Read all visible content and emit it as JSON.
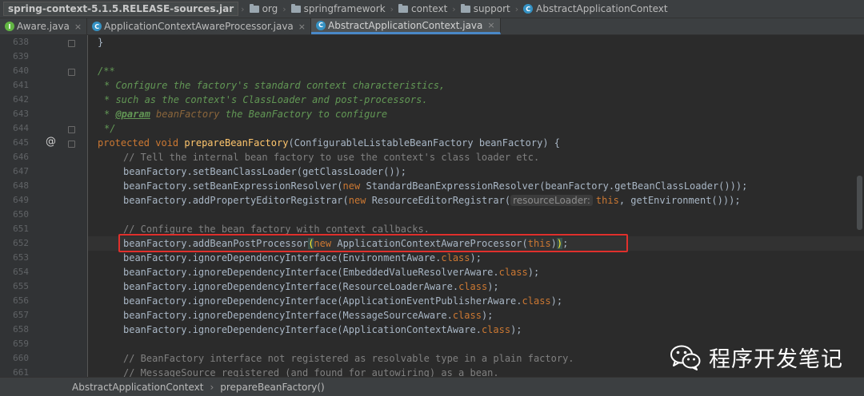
{
  "navbar": {
    "crumbs": [
      "spring-context-5.1.5.RELEASE-sources.jar",
      "org",
      "springframework",
      "context",
      "support",
      "AbstractApplicationContext"
    ]
  },
  "tabs": [
    {
      "label": "Aware.java",
      "icon": "interface-icon",
      "active": false
    },
    {
      "label": "ApplicationContextAwareProcessor.java",
      "icon": "class-icon",
      "active": false
    },
    {
      "label": "AbstractApplicationContext.java",
      "icon": "class-icon",
      "active": true
    }
  ],
  "line_numbers": [
    "638",
    "639",
    "640",
    "641",
    "642",
    "643",
    "644",
    "645",
    "646",
    "647",
    "648",
    "649",
    "650",
    "651",
    "652",
    "653",
    "654",
    "655",
    "656",
    "657",
    "658",
    "659",
    "660",
    "661"
  ],
  "code": {
    "l638": "}",
    "l640": "/**",
    "l641": "* Configure the factory's standard context characteristics,",
    "l642": "* such as the context's ClassLoader and post-processors.",
    "l643_tag": "@param",
    "l643_name": "beanFactory",
    "l643_rest": "the BeanFactory to configure",
    "l644": "*/",
    "l645_kw": "protected void",
    "l645_fn": "prepareBeanFactory",
    "l645_rest": "(ConfigurableListableBeanFactory beanFactory) {",
    "l646": "// Tell the internal bean factory to use the context's class loader etc.",
    "l647": "beanFactory.setBeanClassLoader(getClassLoader());",
    "l648_a": "beanFactory.setBeanExpressionResolver(",
    "l648_kw": "new",
    "l648_b": "StandardBeanExpressionResolver(beanFactory.getBeanClassLoader()));",
    "l649_a": "beanFactory.addPropertyEditorRegistrar(",
    "l649_kw": "new",
    "l649_b": "ResourceEditorRegistrar(",
    "l649_hint": "resourceLoader:",
    "l649_this": "this",
    "l649_c": ", getEnvironment()));",
    "l651": "// Configure the bean factory with context callbacks.",
    "l652_a": "beanFactory.addBeanPostProcessor",
    "l652_open": "(",
    "l652_kw": "new",
    "l652_b": "ApplicationContextAwareProcessor(",
    "l652_this": "this",
    "l652_c": ")",
    "l652_close": ")",
    "l652_end": ";",
    "ignore_prefix": "beanFactory.ignoreDependencyInterface(",
    "class_kw": "class",
    "ignore": [
      "EnvironmentAware",
      "EmbeddedValueResolverAware",
      "ResourceLoaderAware",
      "ApplicationEventPublisherAware",
      "MessageSourceAware",
      "ApplicationContextAware"
    ],
    "l660": "// BeanFactory interface not registered as resolvable type in a plain factory.",
    "l661": "// MessageSource registered (and found for autowiring) as a bean."
  },
  "watermark": {
    "text": "程序开发笔记",
    "icon": "wechat-icon"
  },
  "bottom_breadcrumb": [
    "AbstractApplicationContext",
    "prepareBeanFactory()"
  ]
}
